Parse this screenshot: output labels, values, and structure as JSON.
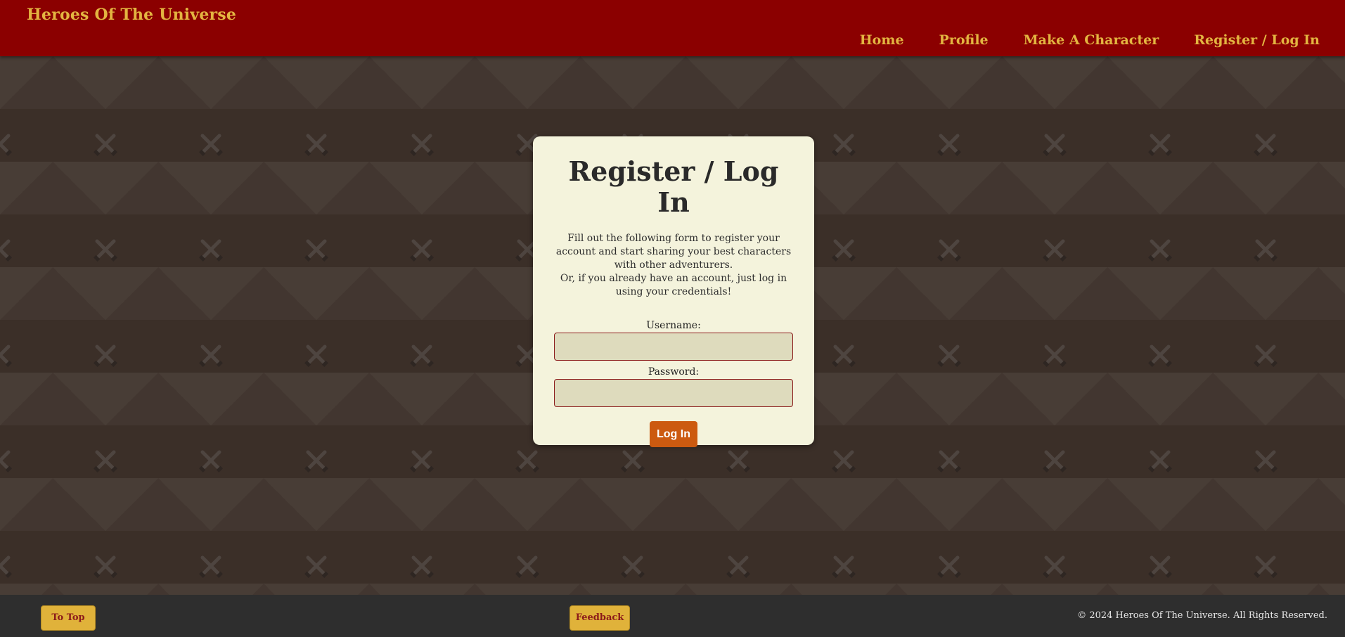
{
  "header": {
    "brand": "Heroes Of The Universe",
    "nav": [
      "Home",
      "Profile",
      "Make A Character",
      "Register / Log In"
    ]
  },
  "card": {
    "title": "Register / Log In",
    "intro_line1": "Fill out the following form to register your account and start sharing your best characters with other adventurers.",
    "intro_line2": "Or, if you already have an account, just log in using your credentials!",
    "username_label": "Username:",
    "username_value": "",
    "password_label": "Password:",
    "password_value": "",
    "submit_label": "Log In"
  },
  "footer": {
    "to_top_label": "To Top",
    "feedback_label": "Feedback",
    "copyright": "© 2024 Heroes Of The Universe. All Rights Reserved."
  },
  "colors": {
    "header_bg": "#8b0000",
    "accent_gold": "#e3b541",
    "card_bg": "#f4f3dc",
    "login_button": "#cc5a10",
    "footer_bg": "#2e2e2e"
  }
}
